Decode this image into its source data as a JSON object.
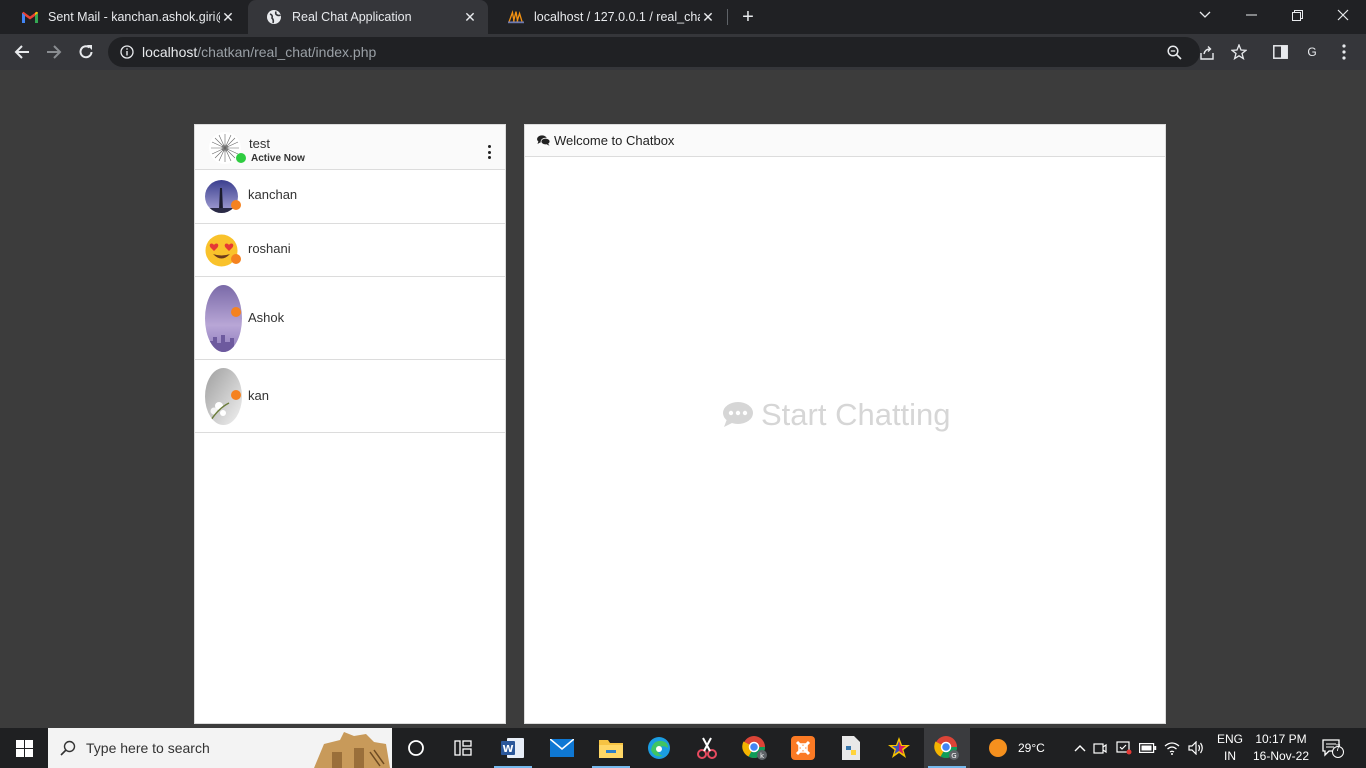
{
  "browser": {
    "tabs": [
      {
        "title": "Sent Mail - kanchan.ashok.giri@g",
        "favicon": "gmail-icon",
        "active": false
      },
      {
        "title": "Real Chat Application",
        "favicon": "globe-icon",
        "active": true
      },
      {
        "title": "localhost / 127.0.0.1 / real_chat /",
        "favicon": "phpmyadmin-icon",
        "active": false
      }
    ],
    "url_host": "localhost",
    "url_path": "/chatkan/real_chat/index.php",
    "profile_initial": "G"
  },
  "sidebar": {
    "me": {
      "name": "test",
      "status": "Active Now"
    },
    "users": [
      {
        "name": "kanchan"
      },
      {
        "name": "roshani"
      },
      {
        "name": "Ashok"
      },
      {
        "name": "kan"
      }
    ]
  },
  "chat": {
    "header": "Welcome to Chatbox",
    "placeholder": "Start Chatting"
  },
  "taskbar": {
    "search_placeholder": "Type here to search",
    "weather": "29°C",
    "lang_top": "ENG",
    "lang_bottom": "IN",
    "time": "10:17 PM",
    "date": "16-Nov-22",
    "notification_count": "7"
  },
  "colors": {
    "page_bg": "#3c3c3c",
    "online": "#2ecc40",
    "offline": "#f5821f"
  }
}
